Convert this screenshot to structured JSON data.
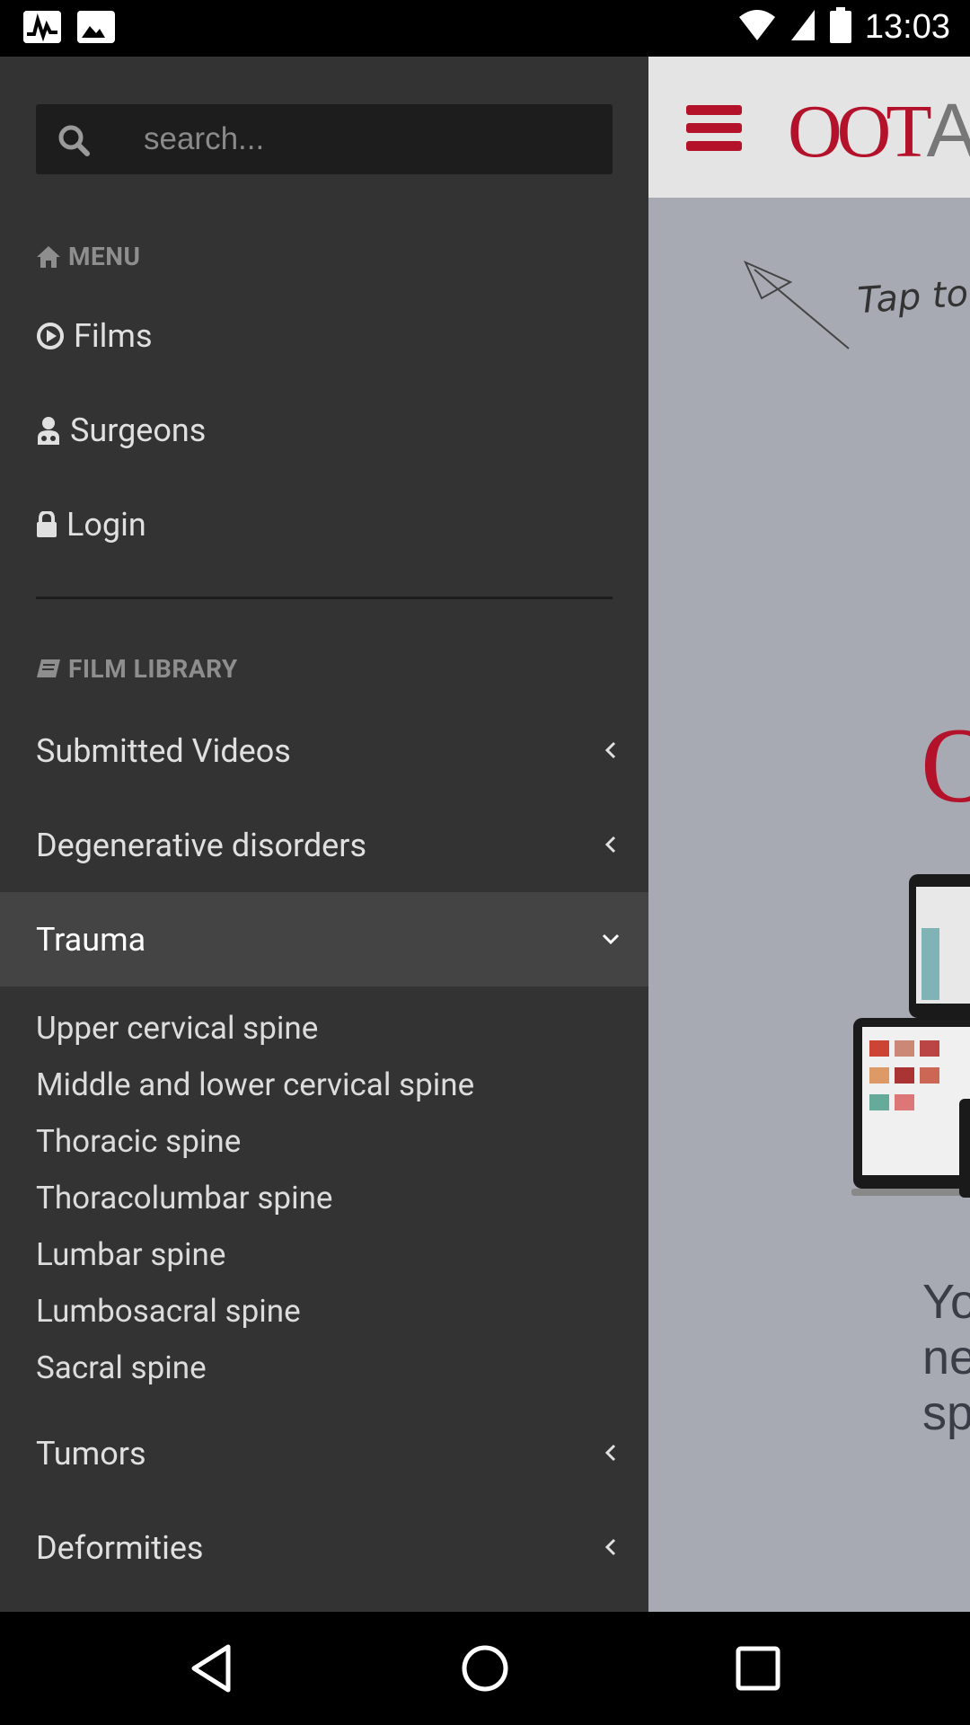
{
  "status_bar": {
    "time": "13:03"
  },
  "app": {
    "logo_main": "OOT",
    "logo_rest": "A",
    "tap_hint": "Tap to",
    "big_logo_letter": "O",
    "promo_lines": [
      "Yo",
      "ne",
      "sp"
    ],
    "accent_color": "#b4122b"
  },
  "drawer": {
    "search": {
      "placeholder": "search..."
    },
    "menu_heading": "MENU",
    "menu_items": [
      {
        "label": "Films",
        "icon": "play-circle-icon"
      },
      {
        "label": "Surgeons",
        "icon": "user-md-icon"
      },
      {
        "label": "Login",
        "icon": "lock-icon"
      }
    ],
    "library_heading": "FILM LIBRARY",
    "library_items": [
      {
        "label": "Submitted Videos",
        "expanded": false
      },
      {
        "label": "Degenerative disorders",
        "expanded": false
      },
      {
        "label": "Trauma",
        "expanded": true
      },
      {
        "label": "Tumors",
        "expanded": false
      },
      {
        "label": "Deformities",
        "expanded": false
      }
    ],
    "trauma_subitems": [
      "Upper cervical spine",
      "Middle and lower cervical spine",
      "Thoracic spine",
      "Thoracolumbar spine",
      "Lumbar spine",
      "Lumbosacral spine",
      "Sacral spine"
    ]
  }
}
